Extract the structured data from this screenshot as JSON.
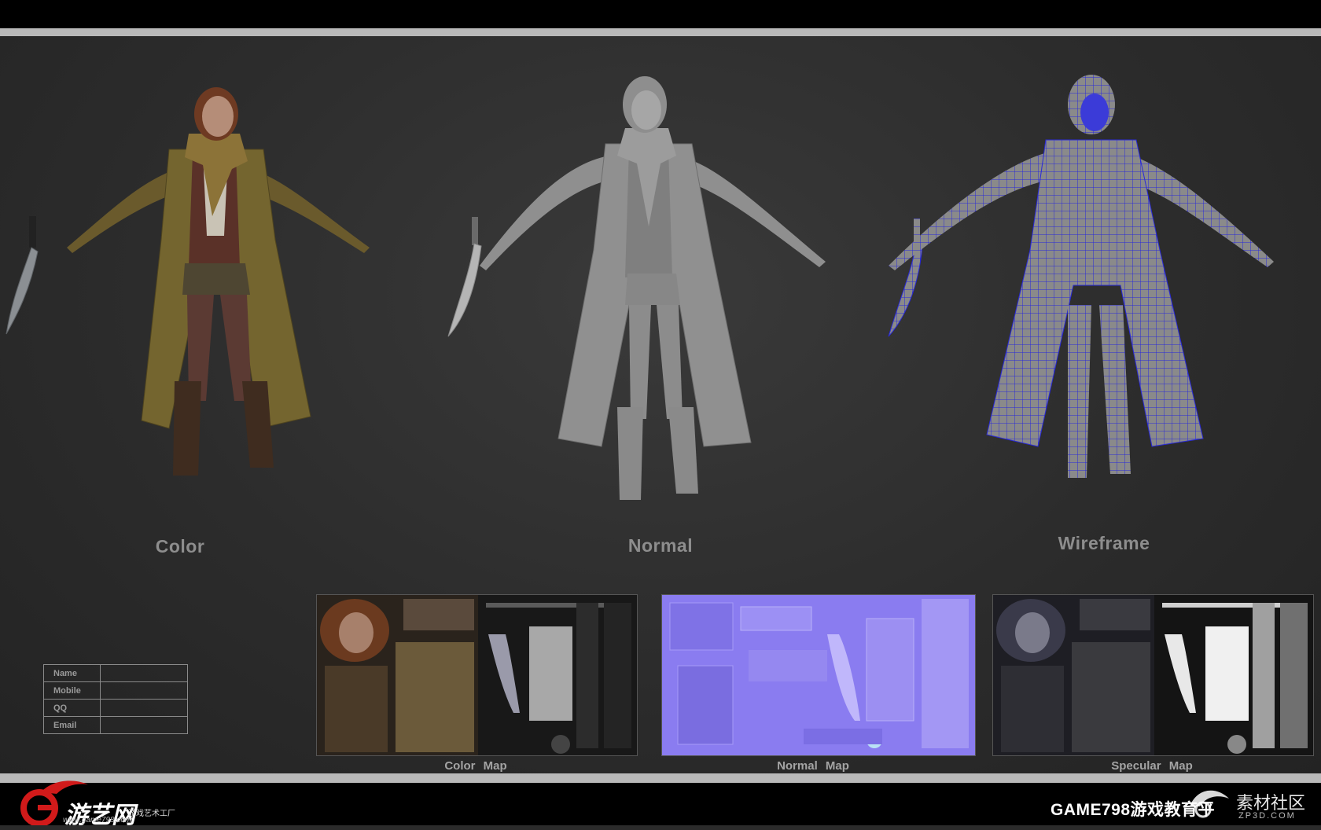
{
  "renders": {
    "color_label": "Color",
    "normal_label": "Normal",
    "wireframe_label": "Wireframe"
  },
  "info_form": {
    "fields": [
      "Name",
      "Mobile",
      "QQ",
      "Email"
    ]
  },
  "maps": {
    "color_map_label": "Color  Map",
    "normal_map_label": "Normal  Map",
    "specular_map_label": "Specular  Map"
  },
  "footer": {
    "logo_name": "游艺网",
    "logo_tagline": "游戏艺术工厂",
    "logo_url": "www.game798.com",
    "right_text": "GAME798游戏教育平",
    "watermark_text": "素材社区",
    "watermark_sub": "ZP3D.COM"
  },
  "colors": {
    "background": "#2b2b2b",
    "bar": "#000000",
    "separator": "#b9b9b9",
    "normal_map": "#8a7cf0",
    "wire": "#2a2ad8"
  }
}
